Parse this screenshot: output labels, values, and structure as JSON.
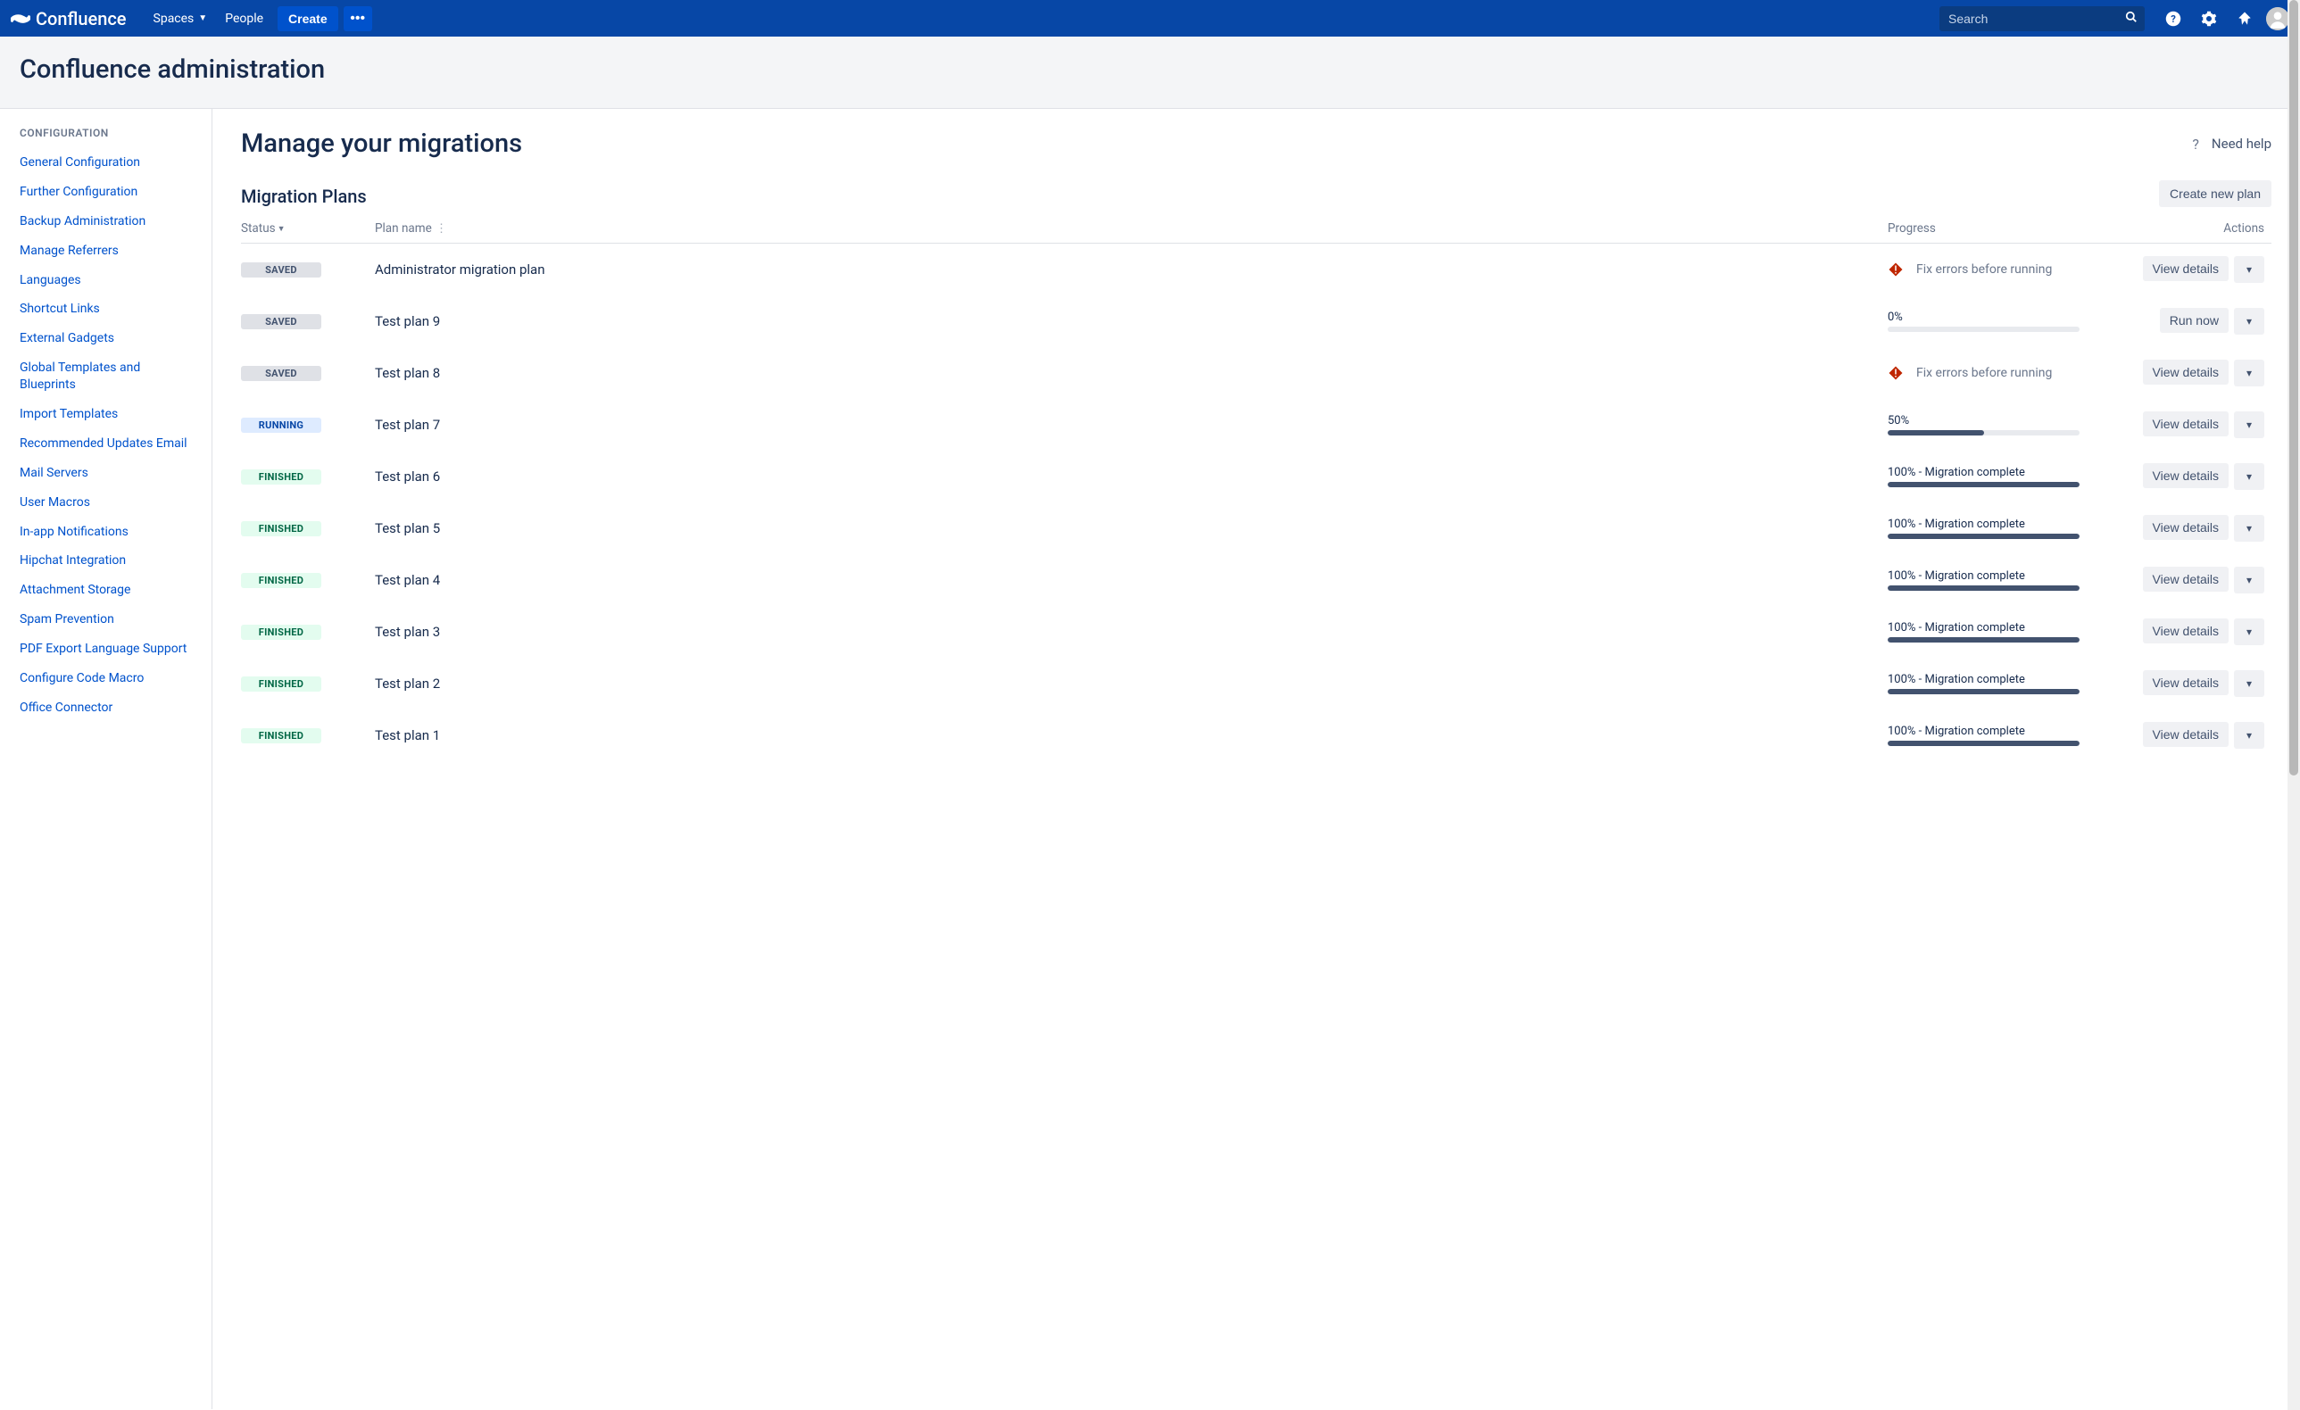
{
  "topnav": {
    "product": "Confluence",
    "spaces": "Spaces",
    "people": "People",
    "create": "Create",
    "search_placeholder": "Search"
  },
  "admin_header": "Confluence administration",
  "sidebar": {
    "heading": "CONFIGURATION",
    "items": [
      "General Configuration",
      "Further Configuration",
      "Backup Administration",
      "Manage Referrers",
      "Languages",
      "Shortcut Links",
      "External Gadgets",
      "Global Templates and Blueprints",
      "Import Templates",
      "Recommended Updates Email",
      "Mail Servers",
      "User Macros",
      "In-app Notifications",
      "Hipchat Integration",
      "Attachment Storage",
      "Spam Prevention",
      "PDF Export Language Support",
      "Configure Code Macro",
      "Office Connector"
    ]
  },
  "main": {
    "title": "Manage your migrations",
    "need_help": "Need help",
    "plans_heading": "Migration Plans",
    "create_plan": "Create new plan",
    "columns": {
      "status": "Status",
      "plan": "Plan name",
      "progress": "Progress",
      "actions": "Actions"
    },
    "labels": {
      "view_details": "View details",
      "run_now": "Run now",
      "saved": "SAVED",
      "running": "RUNNING",
      "finished": "FINISHED",
      "fix_errors": "Fix errors before running",
      "complete": "100% - Migration complete"
    },
    "rows": [
      {
        "status": "saved",
        "name": "Administrator migration plan",
        "progress": {
          "type": "error"
        },
        "action": "view"
      },
      {
        "status": "saved",
        "name": "Test plan 9",
        "progress": {
          "type": "bar",
          "label": "0%",
          "pct": 0
        },
        "action": "run"
      },
      {
        "status": "saved",
        "name": "Test plan 8",
        "progress": {
          "type": "error"
        },
        "action": "view"
      },
      {
        "status": "running",
        "name": "Test plan 7",
        "progress": {
          "type": "bar",
          "label": "50%",
          "pct": 50
        },
        "action": "view"
      },
      {
        "status": "finished",
        "name": "Test plan 6",
        "progress": {
          "type": "bar",
          "label_key": "complete",
          "pct": 100
        },
        "action": "view"
      },
      {
        "status": "finished",
        "name": "Test plan 5",
        "progress": {
          "type": "bar",
          "label_key": "complete",
          "pct": 100
        },
        "action": "view"
      },
      {
        "status": "finished",
        "name": "Test plan 4",
        "progress": {
          "type": "bar",
          "label_key": "complete",
          "pct": 100
        },
        "action": "view"
      },
      {
        "status": "finished",
        "name": "Test plan 3",
        "progress": {
          "type": "bar",
          "label_key": "complete",
          "pct": 100
        },
        "action": "view"
      },
      {
        "status": "finished",
        "name": "Test plan 2",
        "progress": {
          "type": "bar",
          "label_key": "complete",
          "pct": 100
        },
        "action": "view"
      },
      {
        "status": "finished",
        "name": "Test plan 1",
        "progress": {
          "type": "bar",
          "label_key": "complete",
          "pct": 100
        },
        "action": "view"
      }
    ]
  }
}
